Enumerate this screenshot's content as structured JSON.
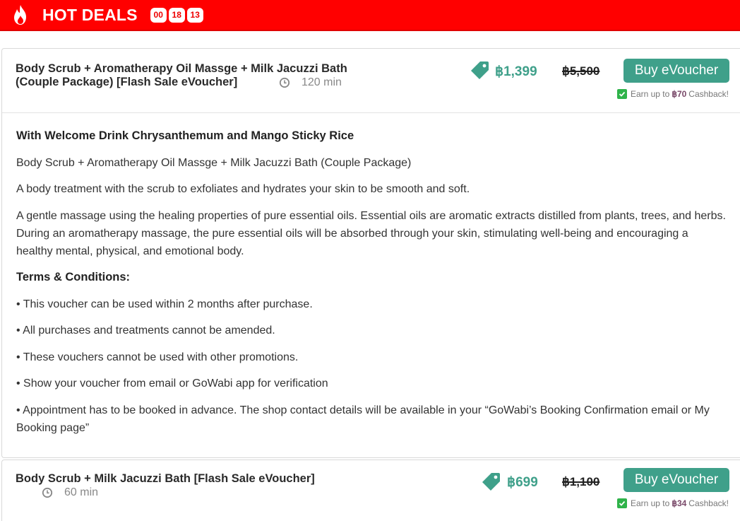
{
  "hot_deals": {
    "title": "HOT DEALS",
    "timer": [
      "00",
      "18",
      "13"
    ]
  },
  "packages": [
    {
      "title": "Body Scrub + Aromatherapy Oil Massge + Milk Jacuzzi Bath (Couple Package) [Flash Sale eVoucher]",
      "duration": "120 min",
      "price": "฿1,399",
      "old_price": "฿5,500",
      "buy_label": "Buy eVoucher",
      "cashback_prefix": "Earn up to",
      "cashback_amount": "฿70",
      "cashback_suffix": "Cashback!",
      "details": {
        "heading": "With Welcome Drink Chrysanthemum and Mango Sticky Rice",
        "name": "Body Scrub + Aromatherapy Oil Massge + Milk Jacuzzi Bath (Couple Package)",
        "desc1": "A body treatment with the scrub to exfoliates and hydrates your skin to be smooth and soft.",
        "desc2": "A gentle massage using the healing properties of pure essential oils. Essential oils are aromatic extracts distilled from plants, trees, and herbs. During an aromatherapy massage, the pure essential oils will be absorbed through your skin, stimulating well-being and encouraging a healthy mental, physical, and emotional body.",
        "terms_heading": "Terms & Conditions:",
        "terms": [
          "• This voucher can be used within 2 months after purchase.",
          "• All purchases and treatments cannot be amended.",
          "• These vouchers cannot be used with other promotions.",
          "• Show your voucher from email or GoWabi app for verification",
          "• Appointment has to be booked in advance. The shop contact details will be available in your “GoWabi’s Booking Confirmation email or My Booking page”"
        ]
      }
    },
    {
      "title": "Body Scrub + Milk Jacuzzi Bath [Flash Sale eVoucher]",
      "duration": "60 min",
      "price": "฿699",
      "old_price": "฿1,100",
      "buy_label": "Buy eVoucher",
      "cashback_prefix": "Earn up to",
      "cashback_amount": "฿34",
      "cashback_suffix": "Cashback!"
    }
  ],
  "colors": {
    "banner": "#ff0000",
    "accent": "#3fa08a",
    "check": "#2fb34a"
  },
  "icons": [
    "flame-icon",
    "clock-icon",
    "price-tag-icon",
    "check-icon"
  ]
}
